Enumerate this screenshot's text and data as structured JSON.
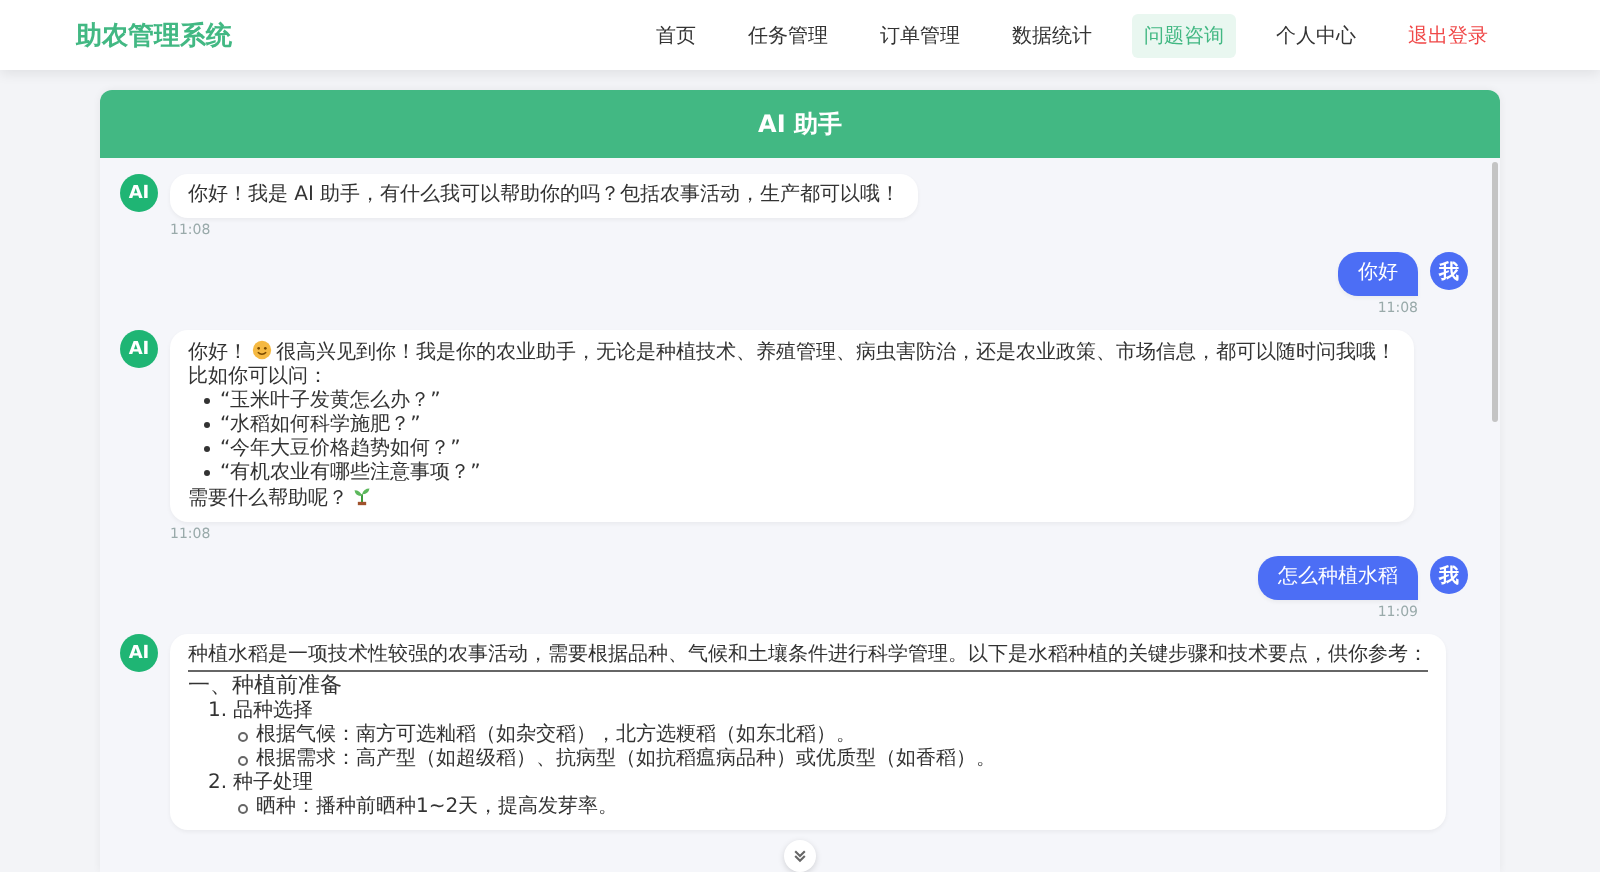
{
  "app": {
    "title": "助农管理系统"
  },
  "nav": [
    {
      "label": "首页",
      "selected": false,
      "kind": "link"
    },
    {
      "label": "任务管理",
      "selected": false,
      "kind": "link"
    },
    {
      "label": "订单管理",
      "selected": false,
      "kind": "link"
    },
    {
      "label": "数据统计",
      "selected": false,
      "kind": "link"
    },
    {
      "label": "问题咨询",
      "selected": true,
      "kind": "link"
    },
    {
      "label": "个人中心",
      "selected": false,
      "kind": "link"
    },
    {
      "label": "退出登录",
      "selected": false,
      "kind": "logout"
    }
  ],
  "chat": {
    "title": "AI 助手",
    "messages": [
      {
        "from_user": false,
        "avatar": "AI",
        "time": "11:08",
        "blocks": [
          {
            "kind": "text",
            "parts": [
              {
                "kind": "text",
                "text": "你好！我是 AI 助手，有什么我可以帮助你的吗？包括农事活动，生产都可以哦！"
              }
            ]
          }
        ]
      },
      {
        "from_user": true,
        "avatar": "我",
        "time": "11:08",
        "blocks": [
          {
            "kind": "text",
            "parts": [
              {
                "kind": "text",
                "text": "你好"
              }
            ]
          }
        ]
      },
      {
        "from_user": false,
        "avatar": "AI",
        "time": "11:08",
        "blocks": [
          {
            "kind": "text",
            "parts": [
              {
                "kind": "text",
                "text": "你好！"
              },
              {
                "kind": "smile-emoji"
              },
              {
                "kind": "text",
                "text": "很高兴见到你！我是你的农业助手，无论是种植技术、养殖管理、病虫害防治，还是农业政策、市场信息，都可以随时问我哦！"
              }
            ]
          },
          {
            "kind": "text",
            "parts": [
              {
                "kind": "text",
                "text": "比如你可以问："
              }
            ]
          },
          {
            "kind": "bullets",
            "items": [
              "“玉米叶子发黄怎么办？”",
              "“水稻如何科学施肥？”",
              "“今年大豆价格趋势如何？”",
              "“有机农业有哪些注意事项？”"
            ]
          },
          {
            "kind": "text",
            "parts": [
              {
                "kind": "text",
                "text": "需要什么帮助呢？"
              },
              {
                "kind": "sprout-emoji"
              }
            ]
          }
        ]
      },
      {
        "from_user": true,
        "avatar": "我",
        "time": "11:09",
        "blocks": [
          {
            "kind": "text",
            "parts": [
              {
                "kind": "text",
                "text": "怎么种植水稻"
              }
            ]
          }
        ]
      },
      {
        "from_user": false,
        "avatar": "AI",
        "blocks": [
          {
            "kind": "intro",
            "text": "种植水稻是一项技术性较强的农事活动，需要根据品种、气候和土壤条件进行科学管理。以下是水稻种植的关键步骤和技术要点，供你参考："
          },
          {
            "kind": "heading",
            "text": "一、种植前准备"
          },
          {
            "kind": "step",
            "text": "1. 品种选择",
            "items": [
              "根据气候：南方可选籼稻（如杂交稻），北方选粳稻（如东北稻）。",
              "根据需求：高产型（如超级稻）、抗病型（如抗稻瘟病品种）或优质型（如香稻）。"
            ]
          },
          {
            "kind": "step",
            "text": "2. 种子处理",
            "items": [
              "晒种：播种前晒种1~2天，提高发芽率。"
            ]
          }
        ]
      }
    ]
  }
}
